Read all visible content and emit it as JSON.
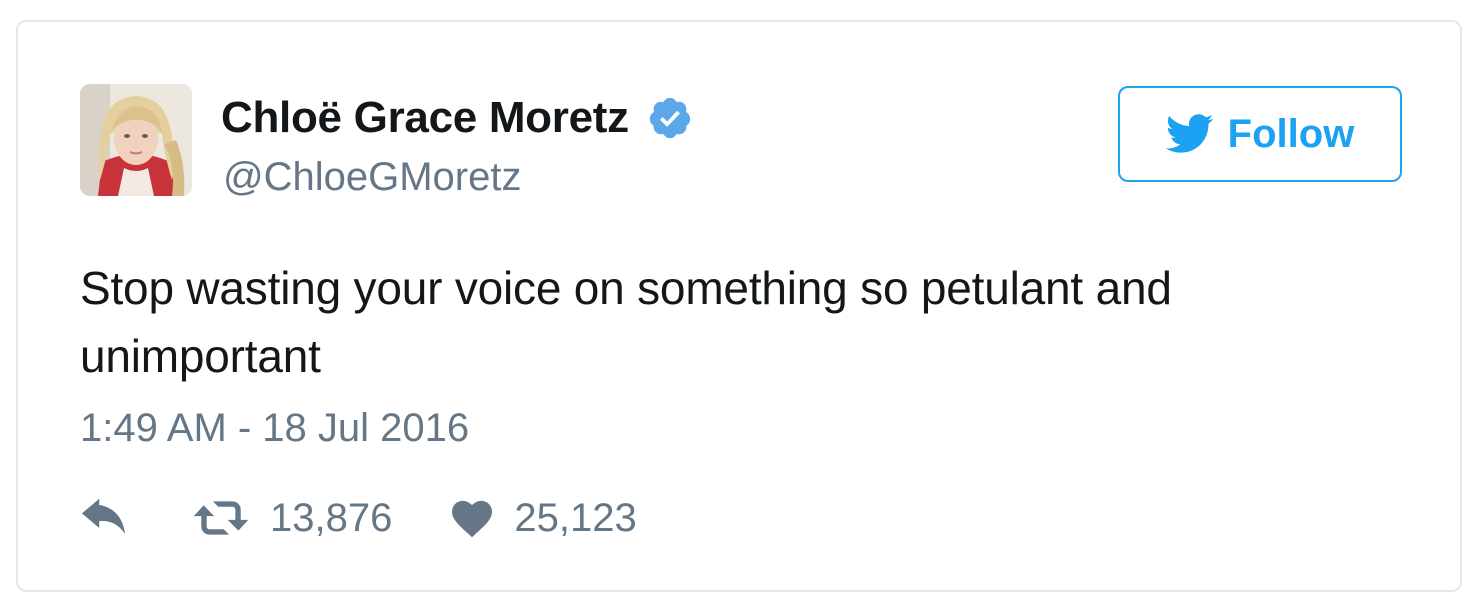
{
  "user": {
    "display_name": "Chloë Grace Moretz",
    "handle": "@ChloeGMoretz",
    "verified": true,
    "avatar_icon": "profile-photo"
  },
  "follow_button": {
    "label": "Follow",
    "icon": "twitter-bird-icon"
  },
  "tweet": {
    "text": "Stop wasting your voice on something so petulant and unimportant",
    "timestamp": "1:49 AM - 18 Jul 2016"
  },
  "actions": {
    "reply_icon": "reply-icon",
    "retweet_icon": "retweet-icon",
    "retweet_count": "13,876",
    "like_icon": "heart-icon",
    "like_count": "25,123"
  },
  "colors": {
    "accent": "#1da1f2",
    "text": "#14171a",
    "secondary_text": "#657786",
    "border": "#e1e8ed"
  }
}
